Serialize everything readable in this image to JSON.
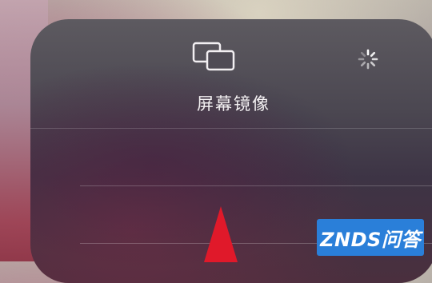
{
  "screen_mirroring": {
    "title": "屏幕镜像",
    "icon": "screen-mirroring-icon",
    "status_icon": "loading-spinner-icon",
    "device_rows": [
      "",
      "",
      ""
    ]
  },
  "overlay": {
    "arrow_icon": "red-arrow-icon",
    "arrow_color": "#e0192a"
  },
  "watermark": {
    "text": "ZNDS问答",
    "color": "#2a7fd9"
  }
}
